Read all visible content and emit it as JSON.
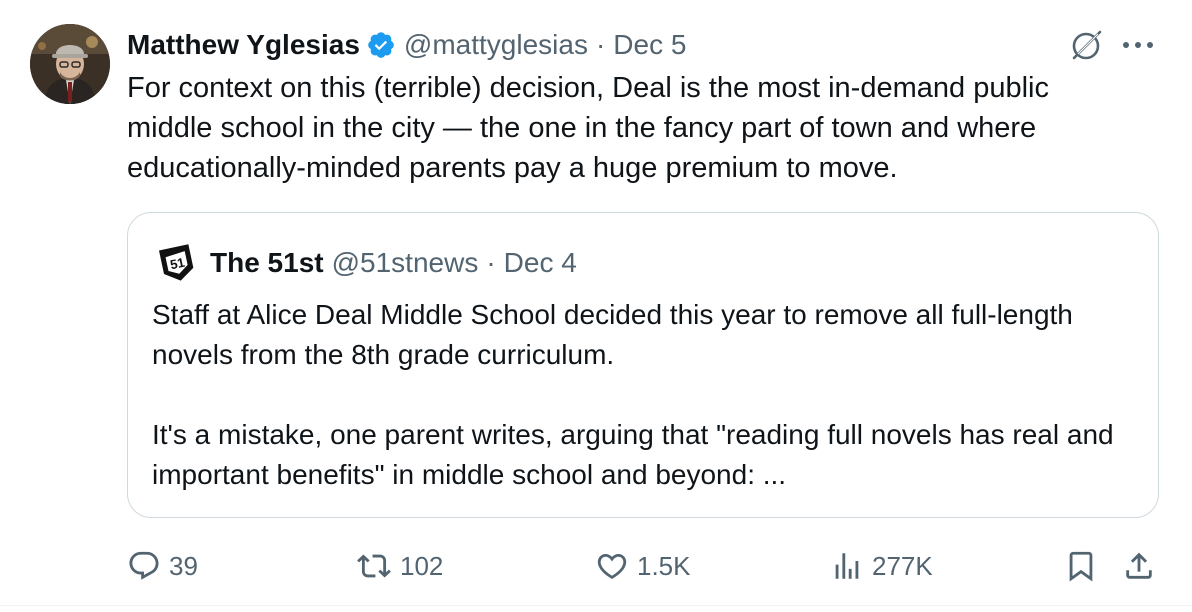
{
  "tweet": {
    "author": {
      "name": "Matthew Yglesias",
      "handle": "@mattyglesias",
      "verified": true,
      "avatar": "profile-photo"
    },
    "separator": "·",
    "date": "Dec 5",
    "lines": [
      "For context on this (terrible) decision, Deal is the most in-demand public",
      "middle school in the city — the one in the fancy part of town and where",
      "educationally-minded parents pay a huge premium to move."
    ]
  },
  "quote": {
    "author": {
      "name": "The 51st",
      "handle": "@51stnews",
      "logo": "the-51st-logo"
    },
    "separator": "·",
    "date": "Dec 4",
    "paragraphs": [
      "Staff at Alice Deal Middle School decided this year to remove all full-length novels from the 8th grade curriculum.",
      "It's a mistake, one parent writes, arguing that \"reading full novels has real and important benefits\" in middle school and beyond: ..."
    ]
  },
  "actions": {
    "replies": "39",
    "reposts": "102",
    "likes": "1.5K",
    "views": "277K"
  },
  "icons": {
    "verified": "verified-badge-icon",
    "grok": "grok-icon",
    "more": "more-icon",
    "reply": "reply-icon",
    "repost": "repost-icon",
    "like": "heart-icon",
    "views": "views-icon",
    "bookmark": "bookmark-icon",
    "share": "share-icon"
  },
  "colors": {
    "text": "#0f1419",
    "secondary": "#536471",
    "verified": "#1d9bf0",
    "border": "#cfd9de"
  }
}
